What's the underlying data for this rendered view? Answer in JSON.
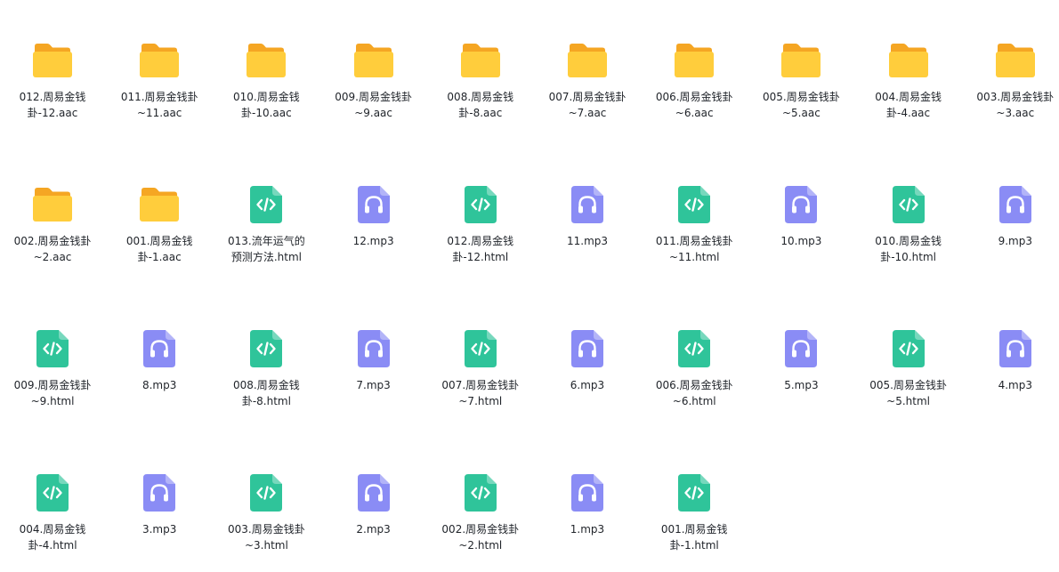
{
  "files": [
    {
      "name": "012.周易金钱\n卦-12.aac",
      "type": "folder",
      "icon": "folder-icon"
    },
    {
      "name": "011.周易金钱卦\n~11.aac",
      "type": "folder",
      "icon": "folder-icon"
    },
    {
      "name": "010.周易金钱\n卦-10.aac",
      "type": "folder",
      "icon": "folder-icon"
    },
    {
      "name": "009.周易金钱卦\n~9.aac",
      "type": "folder",
      "icon": "folder-icon"
    },
    {
      "name": "008.周易金钱\n卦-8.aac",
      "type": "folder",
      "icon": "folder-icon"
    },
    {
      "name": "007.周易金钱卦\n~7.aac",
      "type": "folder",
      "icon": "folder-icon"
    },
    {
      "name": "006.周易金钱卦\n~6.aac",
      "type": "folder",
      "icon": "folder-icon"
    },
    {
      "name": "005.周易金钱卦\n~5.aac",
      "type": "folder",
      "icon": "folder-icon"
    },
    {
      "name": "004.周易金钱\n卦-4.aac",
      "type": "folder",
      "icon": "folder-icon"
    },
    {
      "name": "003.周易金钱卦\n~3.aac",
      "type": "folder",
      "icon": "folder-icon"
    },
    {
      "name": "002.周易金钱卦\n~2.aac",
      "type": "folder",
      "icon": "folder-icon"
    },
    {
      "name": "001.周易金钱\n卦-1.aac",
      "type": "folder",
      "icon": "folder-icon"
    },
    {
      "name": "013.流年运气的\n预测方法.html",
      "type": "html",
      "icon": "html-file-icon"
    },
    {
      "name": "12.mp3",
      "type": "audio",
      "icon": "audio-file-icon"
    },
    {
      "name": "012.周易金钱\n卦-12.html",
      "type": "html",
      "icon": "html-file-icon"
    },
    {
      "name": "11.mp3",
      "type": "audio",
      "icon": "audio-file-icon"
    },
    {
      "name": "011.周易金钱卦\n~11.html",
      "type": "html",
      "icon": "html-file-icon"
    },
    {
      "name": "10.mp3",
      "type": "audio",
      "icon": "audio-file-icon"
    },
    {
      "name": "010.周易金钱\n卦-10.html",
      "type": "html",
      "icon": "html-file-icon"
    },
    {
      "name": "9.mp3",
      "type": "audio",
      "icon": "audio-file-icon"
    },
    {
      "name": "009.周易金钱卦\n~9.html",
      "type": "html",
      "icon": "html-file-icon"
    },
    {
      "name": "8.mp3",
      "type": "audio",
      "icon": "audio-file-icon"
    },
    {
      "name": "008.周易金钱\n卦-8.html",
      "type": "html",
      "icon": "html-file-icon"
    },
    {
      "name": "7.mp3",
      "type": "audio",
      "icon": "audio-file-icon"
    },
    {
      "name": "007.周易金钱卦\n~7.html",
      "type": "html",
      "icon": "html-file-icon"
    },
    {
      "name": "6.mp3",
      "type": "audio",
      "icon": "audio-file-icon"
    },
    {
      "name": "006.周易金钱卦\n~6.html",
      "type": "html",
      "icon": "html-file-icon"
    },
    {
      "name": "5.mp3",
      "type": "audio",
      "icon": "audio-file-icon"
    },
    {
      "name": "005.周易金钱卦\n~5.html",
      "type": "html",
      "icon": "html-file-icon"
    },
    {
      "name": "4.mp3",
      "type": "audio",
      "icon": "audio-file-icon"
    },
    {
      "name": "004.周易金钱\n卦-4.html",
      "type": "html",
      "icon": "html-file-icon"
    },
    {
      "name": "3.mp3",
      "type": "audio",
      "icon": "audio-file-icon"
    },
    {
      "name": "003.周易金钱卦\n~3.html",
      "type": "html",
      "icon": "html-file-icon"
    },
    {
      "name": "2.mp3",
      "type": "audio",
      "icon": "audio-file-icon"
    },
    {
      "name": "002.周易金钱卦\n~2.html",
      "type": "html",
      "icon": "html-file-icon"
    },
    {
      "name": "1.mp3",
      "type": "audio",
      "icon": "audio-file-icon"
    },
    {
      "name": "001.周易金钱\n卦-1.html",
      "type": "html",
      "icon": "html-file-icon"
    }
  ],
  "colors": {
    "folder_back": "#f5a623",
    "folder_front": "#ffcd3c",
    "html_icon": "#2fc49a",
    "audio_icon": "#8a8cf5",
    "text": "#1f2329"
  }
}
